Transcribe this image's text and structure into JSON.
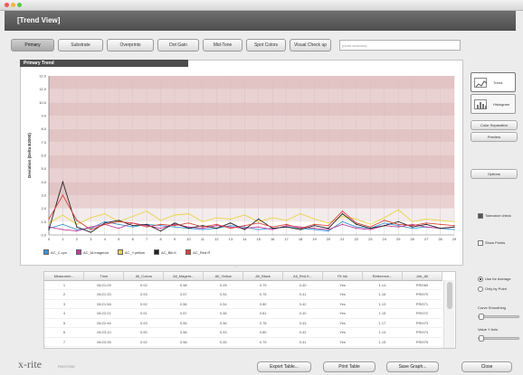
{
  "window": {
    "title": "[Trend View]"
  },
  "colors": {
    "header": "#555555",
    "band_pink": "#e9cfcf",
    "band_white": "#ffffff"
  },
  "tabs": [
    {
      "label": "Primary",
      "active": true
    },
    {
      "label": "Substrate",
      "active": false
    },
    {
      "label": "Overprints",
      "active": false
    },
    {
      "label": "Dot Gain",
      "active": false
    },
    {
      "label": "Mid-Tone",
      "active": false
    },
    {
      "label": "Spot Colors",
      "active": false
    },
    {
      "label": "Visual Check up",
      "active": false
    }
  ],
  "custom_input": {
    "placeholder": "(none selected)"
  },
  "chart": {
    "panel_title": "Primary Trend"
  },
  "chart_data": {
    "type": "line",
    "ylabel": "Deviation (Delta E2000)",
    "yticks": [
      "0.0",
      "1.0",
      "2.0",
      "3.0",
      "4.0",
      "5.0",
      "6.0",
      "7.0",
      "8.0",
      "9.0",
      "10.0",
      "11.0",
      "12.0"
    ],
    "xticks": [
      "0",
      "1",
      "2",
      "3",
      "4",
      "5",
      "6",
      "7",
      "8",
      "9",
      "10",
      "11",
      "12",
      "13",
      "14",
      "15",
      "16",
      "17",
      "18",
      "19",
      "20",
      "21",
      "22",
      "23",
      "24",
      "25",
      "26",
      "27",
      "28",
      "29"
    ],
    "ylim": [
      0,
      12
    ],
    "xlim": [
      0,
      29
    ],
    "grid": true,
    "series": [
      {
        "name": "AC_C.cyn",
        "color": "#3a94d6",
        "values": [
          0.5,
          0.8,
          0.4,
          0.5,
          1.0,
          0.8,
          0.6,
          0.8,
          0.7,
          0.6,
          0.5,
          0.4,
          0.5,
          0.7,
          0.6,
          0.4,
          0.5,
          0.6,
          0.5,
          0.4,
          0.3,
          1.0,
          0.6,
          0.5,
          0.9,
          0.7,
          0.5,
          0.6,
          0.5,
          0.4
        ]
      },
      {
        "name": "AC_M.magenta",
        "color": "#c0399a",
        "values": [
          0.6,
          0.4,
          0.3,
          0.6,
          0.8,
          0.5,
          0.9,
          0.7,
          0.5,
          0.8,
          0.6,
          0.5,
          0.7,
          0.6,
          0.5,
          0.6,
          0.4,
          0.7,
          0.6,
          0.5,
          0.4,
          0.8,
          0.5,
          0.4,
          0.7,
          0.6,
          0.8,
          0.6,
          0.5,
          0.6
        ]
      },
      {
        "name": "AC_Y.yellow",
        "color": "#e8d445",
        "values": [
          0.9,
          1.5,
          0.8,
          1.3,
          1.6,
          1.0,
          1.4,
          1.8,
          1.1,
          1.5,
          1.6,
          1.0,
          1.3,
          1.2,
          1.5,
          1.0,
          1.3,
          1.1,
          1.6,
          1.2,
          0.9,
          1.4,
          1.2,
          0.8,
          1.3,
          1.9,
          1.0,
          1.2,
          1.1,
          1.0
        ]
      },
      {
        "name": "AC_Blk.K",
        "color": "#222222",
        "values": [
          0.4,
          4.0,
          0.6,
          0.2,
          0.9,
          1.1,
          0.7,
          0.8,
          0.3,
          0.9,
          0.5,
          0.7,
          0.5,
          0.9,
          0.4,
          1.2,
          0.5,
          0.6,
          0.4,
          0.7,
          0.5,
          1.6,
          0.8,
          0.5,
          0.7,
          1.0,
          0.6,
          0.8,
          0.5,
          0.6
        ]
      },
      {
        "name": "AC_Red.R",
        "color": "#d6423a",
        "values": [
          1.2,
          3.0,
          1.1,
          0.4,
          0.8,
          1.0,
          0.9,
          0.6,
          0.8,
          0.7,
          0.9,
          0.6,
          0.8,
          0.5,
          0.7,
          0.9,
          0.6,
          0.8,
          0.5,
          0.8,
          0.7,
          1.8,
          0.9,
          0.6,
          1.1,
          0.8,
          0.7,
          0.9,
          0.8,
          0.7
        ]
      }
    ]
  },
  "table": {
    "columns": [
      "Measurem...",
      "Time",
      "All_Colors",
      "All_Magent...",
      "All_Yellow",
      "All_Black",
      "All_Red K...",
      "Fit Ink",
      "Reference...",
      "Job_All"
    ],
    "rows": [
      [
        "1",
        "08:21:09",
        "0.92",
        "0.58",
        "0.28",
        "0.79",
        "0.40",
        "Yes",
        "1.14",
        "PRI069"
      ],
      [
        "2",
        "08:21:33",
        "0.93",
        "0.57",
        "0.34",
        "0.75",
        "0.41",
        "Yes",
        "1.16",
        "PRI070"
      ],
      [
        "3",
        "08:21:58",
        "0.92",
        "0.56",
        "0.34",
        "0.80",
        "0.42",
        "Yes",
        "1.13",
        "PRI071"
      ],
      [
        "4",
        "08:22:21",
        "0.91",
        "0.57",
        "0.38",
        "0.81",
        "0.40",
        "Yes",
        "1.15",
        "PRI072"
      ],
      [
        "5",
        "08:22:46",
        "0.93",
        "0.55",
        "0.36",
        "0.78",
        "0.43",
        "Yes",
        "1.17",
        "PRI073"
      ],
      [
        "6",
        "08:23:10",
        "0.90",
        "0.56",
        "0.33",
        "0.80",
        "0.42",
        "Yes",
        "1.14",
        "PRI074"
      ],
      [
        "7",
        "08:23:35",
        "0.92",
        "0.58",
        "0.35",
        "0.79",
        "0.41",
        "Yes",
        "1.15",
        "PRI075"
      ]
    ]
  },
  "sidebar": {
    "view_trend": "Trend",
    "view_histogram": "Histogram",
    "color_separation": "Color Separation",
    "preview": "Preview",
    "options": "Options",
    "tolerance_check": "Tolerance check",
    "show_points": "Show Points",
    "by_job": "Use for Average",
    "by_point": "Only by Point",
    "smoothing": "Curve Smoothing",
    "value_y_axis": "Value Y Axis"
  },
  "footer": {
    "logo": "x-rite",
    "logo_sub": "PANTONE",
    "buttons": {
      "export": "Export Table...",
      "print": "Print Table",
      "save_graph": "Save Graph...",
      "close": "Close"
    }
  }
}
